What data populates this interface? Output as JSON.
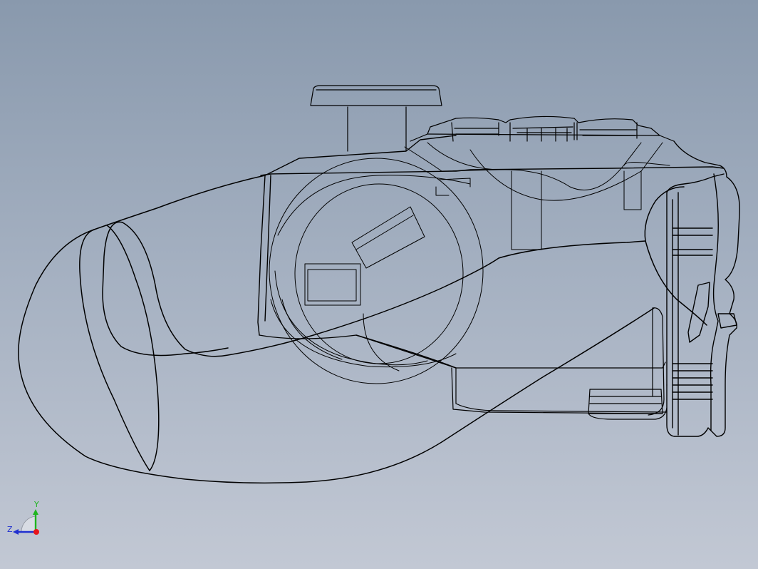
{
  "viewport": {
    "background_top": "#8999ad",
    "background_bottom": "#c2c8d4",
    "edge_color": "#000000",
    "display_mode": "wireframe",
    "model": "game-controller-grip"
  },
  "triad": {
    "x_color": "#e8141a",
    "y_color": "#1fb51f",
    "z_color": "#2030d0",
    "y_label": "Y",
    "z_label": "Z"
  }
}
